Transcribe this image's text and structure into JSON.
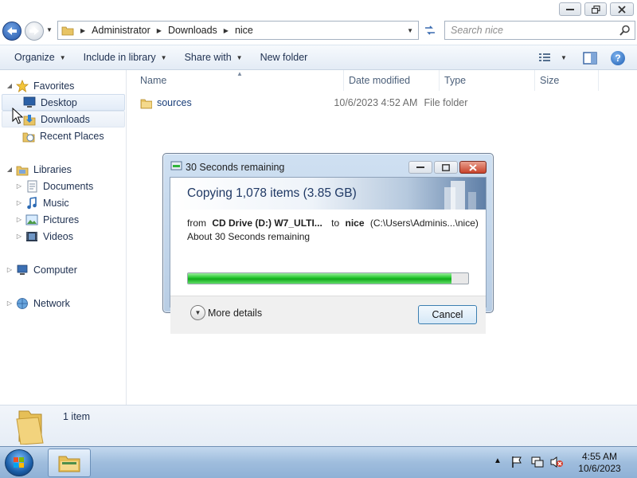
{
  "window": {
    "address": {
      "crumbs": [
        "Administrator",
        "Downloads",
        "nice"
      ]
    },
    "search": {
      "placeholder": "Search nice"
    },
    "toolbar": {
      "organize": "Organize",
      "include_in_library": "Include in library",
      "share_with": "Share with",
      "new_folder": "New folder"
    },
    "nav": {
      "favorites": "Favorites",
      "desktop": "Desktop",
      "downloads": "Downloads",
      "recent_places": "Recent Places",
      "libraries": "Libraries",
      "documents": "Documents",
      "music": "Music",
      "pictures": "Pictures",
      "videos": "Videos",
      "computer": "Computer",
      "network": "Network"
    },
    "columns": {
      "name": "Name",
      "date_modified": "Date modified",
      "type": "Type",
      "size": "Size"
    },
    "files": [
      {
        "name": "sources",
        "date_modified": "10/6/2023 4:52 AM",
        "type": "File folder",
        "size": ""
      }
    ],
    "details": {
      "item_count": "1 item"
    }
  },
  "dialog": {
    "title": "30 Seconds remaining",
    "heading": "Copying 1,078 items (3.85 GB)",
    "from_label": "from",
    "from_value": "CD Drive (D:) W7_ULTI...",
    "to_label": "to",
    "to_value": "nice",
    "to_path": "(C:\\Users\\Adminis...\\nice)",
    "remaining": "About 30 Seconds remaining",
    "progress_fraction": 0.94,
    "more_details": "More details",
    "cancel": "Cancel"
  },
  "taskbar": {
    "time": "4:55 AM",
    "date": "10/6/2023"
  },
  "colors": {
    "progress_green": "#1fc42a",
    "nav_text": "#1e3050",
    "dialog_heading": "#1f3864",
    "taskbar": "#9fbddd"
  }
}
